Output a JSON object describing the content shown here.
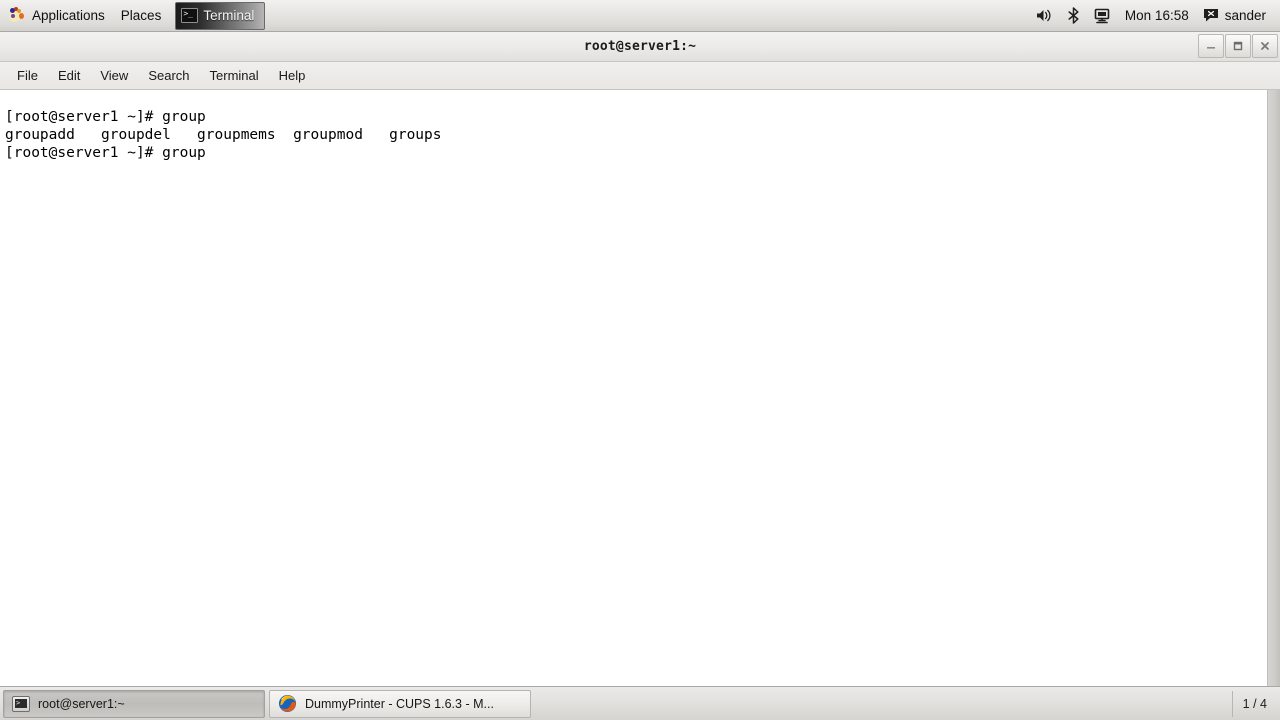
{
  "top_panel": {
    "applications_label": "Applications",
    "places_label": "Places",
    "window_list_button": {
      "label": "Terminal",
      "icon": "terminal-icon"
    },
    "tray": {
      "volume_icon": "volume-icon",
      "bluetooth_icon": "bluetooth-icon",
      "display_icon": "display-icon",
      "clock": "Mon 16:58",
      "user_icon": "chat-bubble-icon",
      "user_name": "sander"
    }
  },
  "terminal_window": {
    "title": "root@server1:~",
    "window_buttons": {
      "minimize": "minimize-icon",
      "maximize": "maximize-icon",
      "close": "close-icon"
    },
    "menu": [
      {
        "label": "File"
      },
      {
        "label": "Edit"
      },
      {
        "label": "View"
      },
      {
        "label": "Search"
      },
      {
        "label": "Terminal"
      },
      {
        "label": "Help"
      }
    ],
    "content": "[root@server1 ~]# group\ngroupadd   groupdel   groupmems  groupmod   groups\n[root@server1 ~]# group",
    "lines": [
      "[root@server1 ~]# group",
      "groupadd   groupdel   groupmems  groupmod   groups",
      "[root@server1 ~]# group"
    ],
    "prompt": "[root@server1 ~]#",
    "typed_command": "group",
    "completions": [
      "groupadd",
      "groupdel",
      "groupmems",
      "groupmod",
      "groups"
    ],
    "colors": {
      "background": "#ffffff",
      "foreground": "#000000"
    }
  },
  "bottom_panel": {
    "tasks": [
      {
        "label": "root@server1:~",
        "icon": "terminal-icon",
        "active": true
      },
      {
        "label": "DummyPrinter - CUPS 1.6.3 - M...",
        "icon": "firefox-icon",
        "active": false
      }
    ],
    "workspace": "1 / 4"
  }
}
